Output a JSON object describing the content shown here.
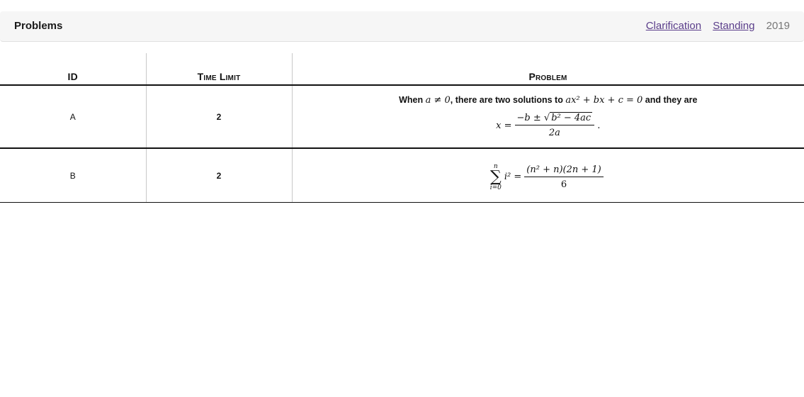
{
  "header": {
    "title": "Problems",
    "links": [
      "Clarification",
      "Standing"
    ],
    "year": "2019"
  },
  "table": {
    "columns": [
      "ID",
      "Time Limit",
      "Problem"
    ],
    "rows": [
      {
        "id": "A",
        "time_limit": "2",
        "statement_when": "When",
        "statement_cond": "a ≠ 0",
        "statement_mid": ", there are two solutions to",
        "statement_eq": "ax² + bx + c = 0",
        "statement_end": "and they are",
        "formula_lhs": "x =",
        "formula_num_a": "−b ±",
        "formula_num_sqrt": "b² − 4ac",
        "formula_den": "2a",
        "formula_tail": "."
      },
      {
        "id": "B",
        "time_limit": "2",
        "sum_upper": "n",
        "sum_symbol": "∑",
        "sum_lower": "i=0",
        "sum_term": "i² =",
        "frac_num": "(n² + n)(2n + 1)",
        "frac_den": "6"
      }
    ]
  }
}
